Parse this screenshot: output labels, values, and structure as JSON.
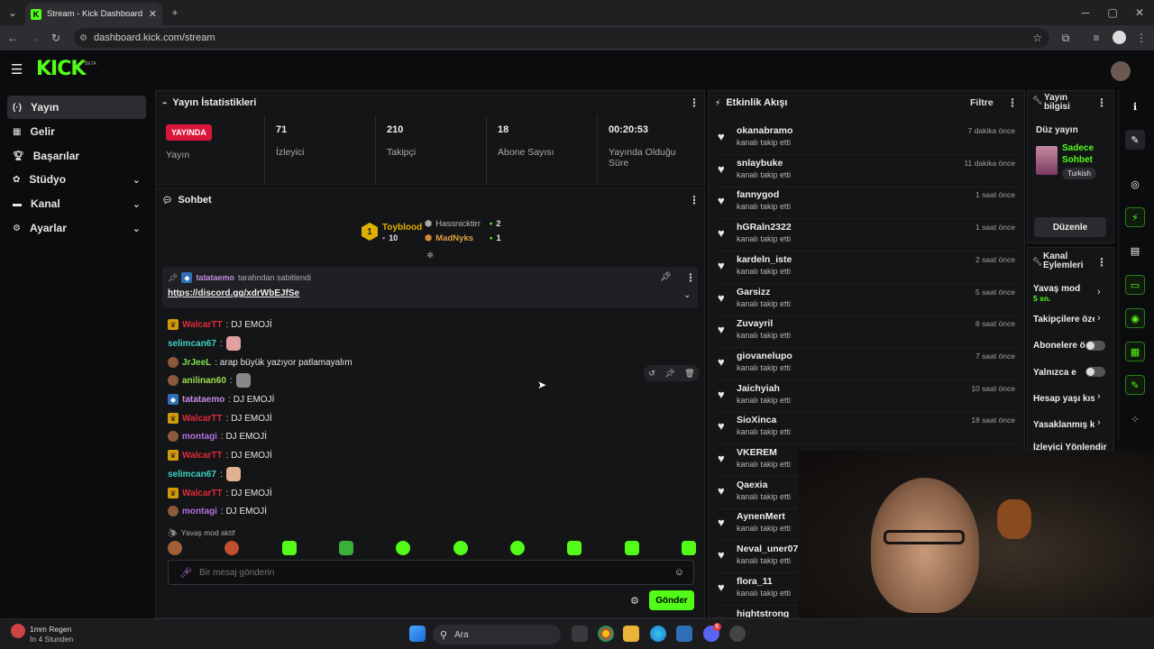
{
  "browser": {
    "tab_title": "Stream - Kick Dashboard",
    "url": "dashboard.kick.com/stream"
  },
  "header": {
    "logo": "KICK",
    "beta": "BETA"
  },
  "sidebar": {
    "items": [
      {
        "label": "Yayın",
        "icon": "broadcast-icon"
      },
      {
        "label": "Gelir",
        "icon": "revenue-icon"
      },
      {
        "label": "Başarılar",
        "icon": "trophy-icon"
      },
      {
        "label": "Stüdyo",
        "icon": "studio-icon"
      },
      {
        "label": "Kanal",
        "icon": "channel-icon"
      },
      {
        "label": "Ayarlar",
        "icon": "gear-icon"
      }
    ]
  },
  "stats": {
    "title": "Yayın İstatistikleri",
    "live_badge": "YAYINDA",
    "live_label": "Yayın",
    "viewers": {
      "value": "71",
      "label": "İzleyici"
    },
    "followers": {
      "value": "210",
      "label": "Takipçi"
    },
    "subscribers": {
      "value": "18",
      "label": "Abone Sayısı"
    },
    "uptime": {
      "value": "00:20:53",
      "label": "Yayında Olduğu Süre"
    }
  },
  "chat": {
    "title": "Sohbet",
    "leaderboard": {
      "first": {
        "rank": "1",
        "name": "Toyblood",
        "count": "10"
      },
      "second": {
        "name": "Hassnicktirr",
        "count": "2"
      },
      "third": {
        "name": "MadNyks",
        "count": "1"
      }
    },
    "pinned": {
      "by_user": "tatataemo",
      "by_text": "tarafından sabitlendi",
      "link": "https://discord.gg/xdrWbEJfSe"
    },
    "messages": [
      {
        "user": "WalcarTT",
        "color": "#e02a3a",
        "text": ": DJ EMOJİ",
        "badge": "crown"
      },
      {
        "user": "selimcan67",
        "color": "#3fd0c4",
        "text": ":",
        "badge": "",
        "emote": "#e0a0a0"
      },
      {
        "user": "JrJeeL",
        "color": "#7fe04a",
        "text": ": arap büyük yazıyor patlamayalım",
        "badge": "avatar"
      },
      {
        "user": "anilinan60",
        "color": "#9be04a",
        "text": ":",
        "badge": "avatar",
        "emote": "#888"
      },
      {
        "user": "tatataemo",
        "color": "#c48ce0",
        "text": ": DJ EMOJİ",
        "badge": "vip"
      },
      {
        "user": "WalcarTT",
        "color": "#e02a3a",
        "text": ": DJ EMOJİ",
        "badge": "crown"
      },
      {
        "user": "montagi",
        "color": "#b070e0",
        "text": ": DJ EMOJİ",
        "badge": "avatar"
      },
      {
        "user": "WalcarTT",
        "color": "#e02a3a",
        "text": ": DJ EMOJİ",
        "badge": "crown"
      },
      {
        "user": "selimcan67",
        "color": "#3fd0c4",
        "text": ":",
        "badge": "",
        "emote": "#e0b090"
      },
      {
        "user": "WalcarTT",
        "color": "#e02a3a",
        "text": ": DJ EMOJİ",
        "badge": "crown"
      },
      {
        "user": "montagi",
        "color": "#b070e0",
        "text": ": DJ EMOJİ",
        "badge": "avatar"
      }
    ],
    "slow_mode_notice": "Yavaş mod aktif",
    "input_placeholder": "Bir mesaj gönderin",
    "send_label": "Gönder"
  },
  "activity": {
    "title": "Etkinlik Akışı",
    "filter_label": "Filtre",
    "items": [
      {
        "name": "okanabramo",
        "sub": "kanalı takip etti",
        "time": "7 dakika önce"
      },
      {
        "name": "snlaybuke",
        "sub": "kanalı takip etti",
        "time": "11 dakika önce"
      },
      {
        "name": "fannygod",
        "sub": "kanalı takip etti",
        "time": "1 saat önce"
      },
      {
        "name": "hGRaln2322",
        "sub": "kanalı takip etti",
        "time": "1 saat önce"
      },
      {
        "name": "kardeln_iste",
        "sub": "kanalı takip etti",
        "time": "2 saat önce"
      },
      {
        "name": "Garsizz",
        "sub": "kanalı takip etti",
        "time": "5 saat önce"
      },
      {
        "name": "Zuvayril",
        "sub": "kanalı takip etti",
        "time": "6 saat önce"
      },
      {
        "name": "giovanelupo",
        "sub": "kanalı takip etti",
        "time": "7 saat önce"
      },
      {
        "name": "Jaichyiah",
        "sub": "kanalı takip etti",
        "time": "10 saat önce"
      },
      {
        "name": "SioXinca",
        "sub": "kanalı takip etti",
        "time": "18 saat önce"
      },
      {
        "name": "VKEREM",
        "sub": "kanalı takip etti",
        "time": ""
      },
      {
        "name": "Qaexia",
        "sub": "kanalı takip etti",
        "time": ""
      },
      {
        "name": "AynenMert",
        "sub": "kanalı takip etti",
        "time": ""
      },
      {
        "name": "Neval_uner07",
        "sub": "kanalı takip etti",
        "time": ""
      },
      {
        "name": "flora_11",
        "sub": "kanalı takip etti",
        "time": ""
      },
      {
        "name": "hightstrong",
        "sub": "",
        "time": ""
      }
    ]
  },
  "stream_info": {
    "title": "Yayın bilgisi",
    "stream_name": "Düz yayın",
    "category": "Sadece Sohbet",
    "tag": "Turkish",
    "edit_label": "Düzenle"
  },
  "channel_actions": {
    "title": "Kanal Eylemleri",
    "slow_mode": "Yavaş mod",
    "slow_mode_value": "5 sn.",
    "followers_only": "Takipçilere özel",
    "subscribers_only": "Abonelere özel",
    "emote_only": "Yalnızca emote",
    "account_age": "Hesap yaşı kısıtlaması",
    "banned_words": "Yasaklanmış kelimeler",
    "viewer_redirect": "İzleyici Yönlendir"
  },
  "taskbar": {
    "notification_title": "1mm Regen",
    "notification_sub": "In 4 Stunden",
    "search_label": "Ara",
    "discord_badge": "6"
  },
  "colors": {
    "brand": "#53fc18",
    "live": "#d8163a"
  }
}
